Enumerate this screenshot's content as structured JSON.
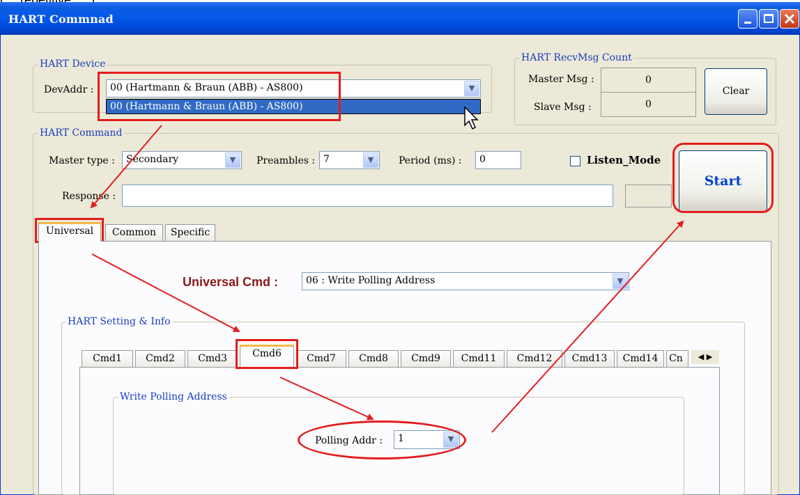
{
  "caption": "(… repetitive … )",
  "window": {
    "title": "HART Commnad"
  },
  "device": {
    "group_label": "HART Device",
    "devaddr_label": "DevAddr :",
    "devaddr_value": "00  (Hartmann & Braun (ABB) - AS800)",
    "dropdown_option": "00  (Hartmann & Braun (ABB) - AS800)"
  },
  "recv": {
    "group_label": "HART RecvMsg Count",
    "master_label": "Master Msg :",
    "master_value": "0",
    "slave_label": "Slave Msg :",
    "slave_value": "0",
    "clear_label": "Clear"
  },
  "command": {
    "group_label": "HART Command",
    "master_type_label": "Master type :",
    "master_type_value": "Secondary",
    "preambles_label": "Preambles :",
    "preambles_value": "7",
    "period_label": "Period (ms) :",
    "period_value": "0",
    "listen_label": "Listen_Mode",
    "start_label": "Start",
    "response_label": "Response :",
    "response_value": ""
  },
  "main_tabs": [
    "Universal",
    "Common",
    "Specific"
  ],
  "universal": {
    "cmd_label": "Universal Cmd :",
    "cmd_value": "06 : Write Polling Address",
    "setting_group_label": "HART Setting & Info"
  },
  "cmd_tabs": [
    "Cmd1",
    "Cmd2",
    "Cmd3",
    "Cmd6",
    "Cmd7",
    "Cmd8",
    "Cmd9",
    "Cmd11",
    "Cmd12",
    "Cmd13",
    "Cmd14",
    "Cn"
  ],
  "cmd6": {
    "group_label": "Write Polling Address",
    "polling_label": "Polling Addr :",
    "polling_value": "1"
  },
  "annotation_color": "#e31d1d",
  "accent_color": "#0040d0"
}
